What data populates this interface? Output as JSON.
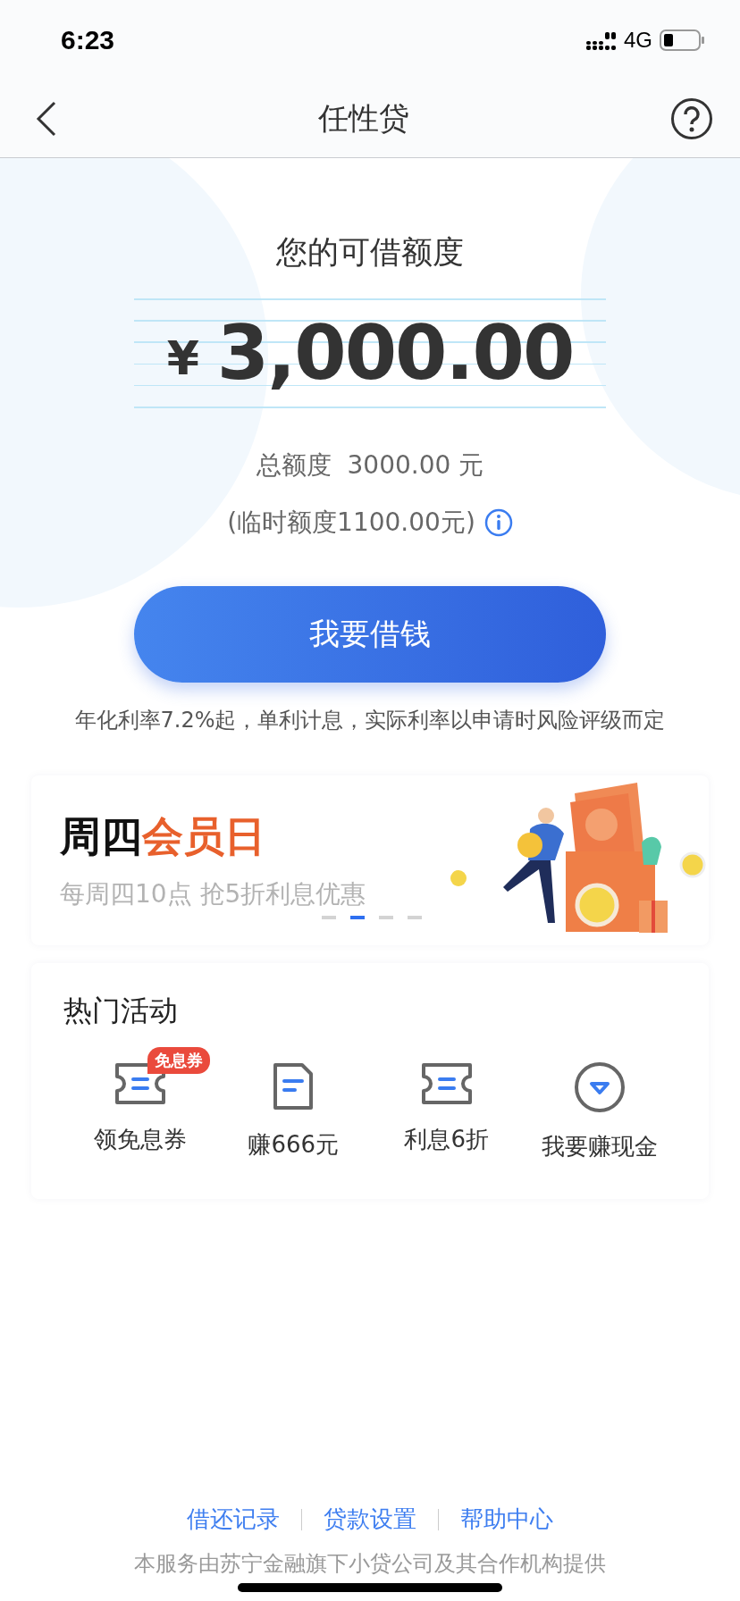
{
  "status_bar": {
    "time": "6:23",
    "network": "4G"
  },
  "nav": {
    "title": "任性贷"
  },
  "credit": {
    "label": "您的可借额度",
    "currency": "¥",
    "amount": "3,000.00",
    "total": "总额度  3000.00 元",
    "temporary": "(临时额度1100.00元)"
  },
  "borrow_button": "我要借钱",
  "rate_note": "年化利率7.2%起，单利计息，实际利率以申请时风险评级而定",
  "banner": {
    "title_plain": "周四",
    "title_accent": "会员日",
    "subtitle": "每周四10点 抢5折利息优惠",
    "dots": [
      {
        "selected": false
      },
      {
        "selected": true
      },
      {
        "selected": false
      },
      {
        "selected": false
      }
    ]
  },
  "hot": {
    "title": "热门活动",
    "items": [
      {
        "kind": "ticket",
        "label": "领免息券",
        "badge": "免息券"
      },
      {
        "kind": "document",
        "label": "赚666元"
      },
      {
        "kind": "ticket",
        "label": "利息6折"
      },
      {
        "kind": "gem",
        "label": "我要赚现金"
      }
    ]
  },
  "footer": {
    "links": [
      "借还记录",
      "贷款设置",
      "帮助中心"
    ],
    "disclaimer": "本服务由苏宁金融旗下小贷公司及其合作机构提供"
  }
}
